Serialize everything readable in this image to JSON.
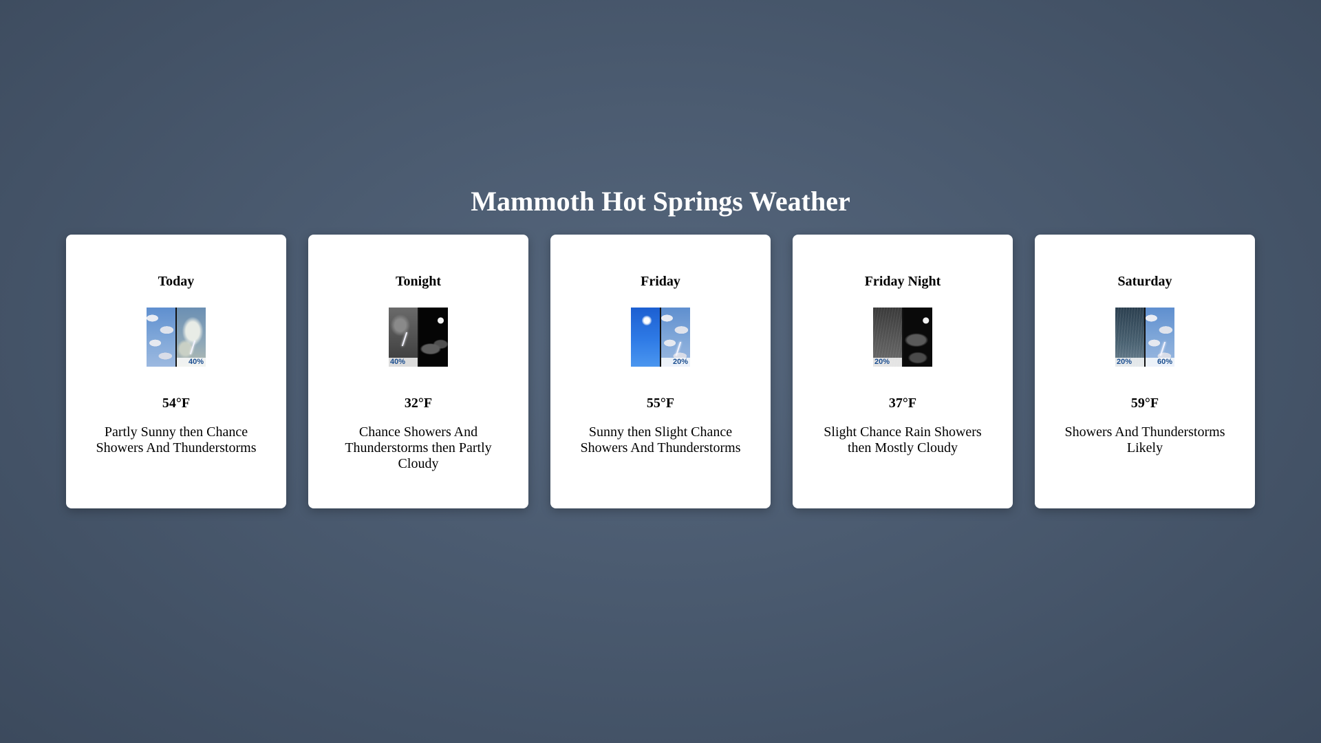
{
  "page": {
    "title": "Mammoth Hot Springs Weather"
  },
  "forecast": [
    {
      "period": "Today",
      "temperature": "54°F",
      "description": "Partly Sunny then Chance Showers And Thunderstorms",
      "icon_left": "partly-sunny-icon",
      "icon_right": "thunderstorm-icon",
      "pop_left": "",
      "pop_right": "40%"
    },
    {
      "period": "Tonight",
      "temperature": "32°F",
      "description": "Chance Showers And Thunderstorms then Partly Cloudy",
      "icon_left": "thunderstorm-icon",
      "icon_right": "partly-cloudy-night-icon",
      "pop_left": "40%",
      "pop_right": ""
    },
    {
      "period": "Friday",
      "temperature": "55°F",
      "description": "Sunny then Slight Chance Showers And Thunderstorms",
      "icon_left": "sunny-icon",
      "icon_right": "thunderstorm-icon",
      "pop_left": "",
      "pop_right": "20%"
    },
    {
      "period": "Friday Night",
      "temperature": "37°F",
      "description": "Slight Chance Rain Showers then Mostly Cloudy",
      "icon_left": "rain-showers-icon",
      "icon_right": "mostly-cloudy-night-icon",
      "pop_left": "20%",
      "pop_right": ""
    },
    {
      "period": "Saturday",
      "temperature": "59°F",
      "description": "Showers And Thunderstorms Likely",
      "icon_left": "showers-icon",
      "icon_right": "thunderstorm-icon",
      "pop_left": "20%",
      "pop_right": "60%"
    }
  ]
}
